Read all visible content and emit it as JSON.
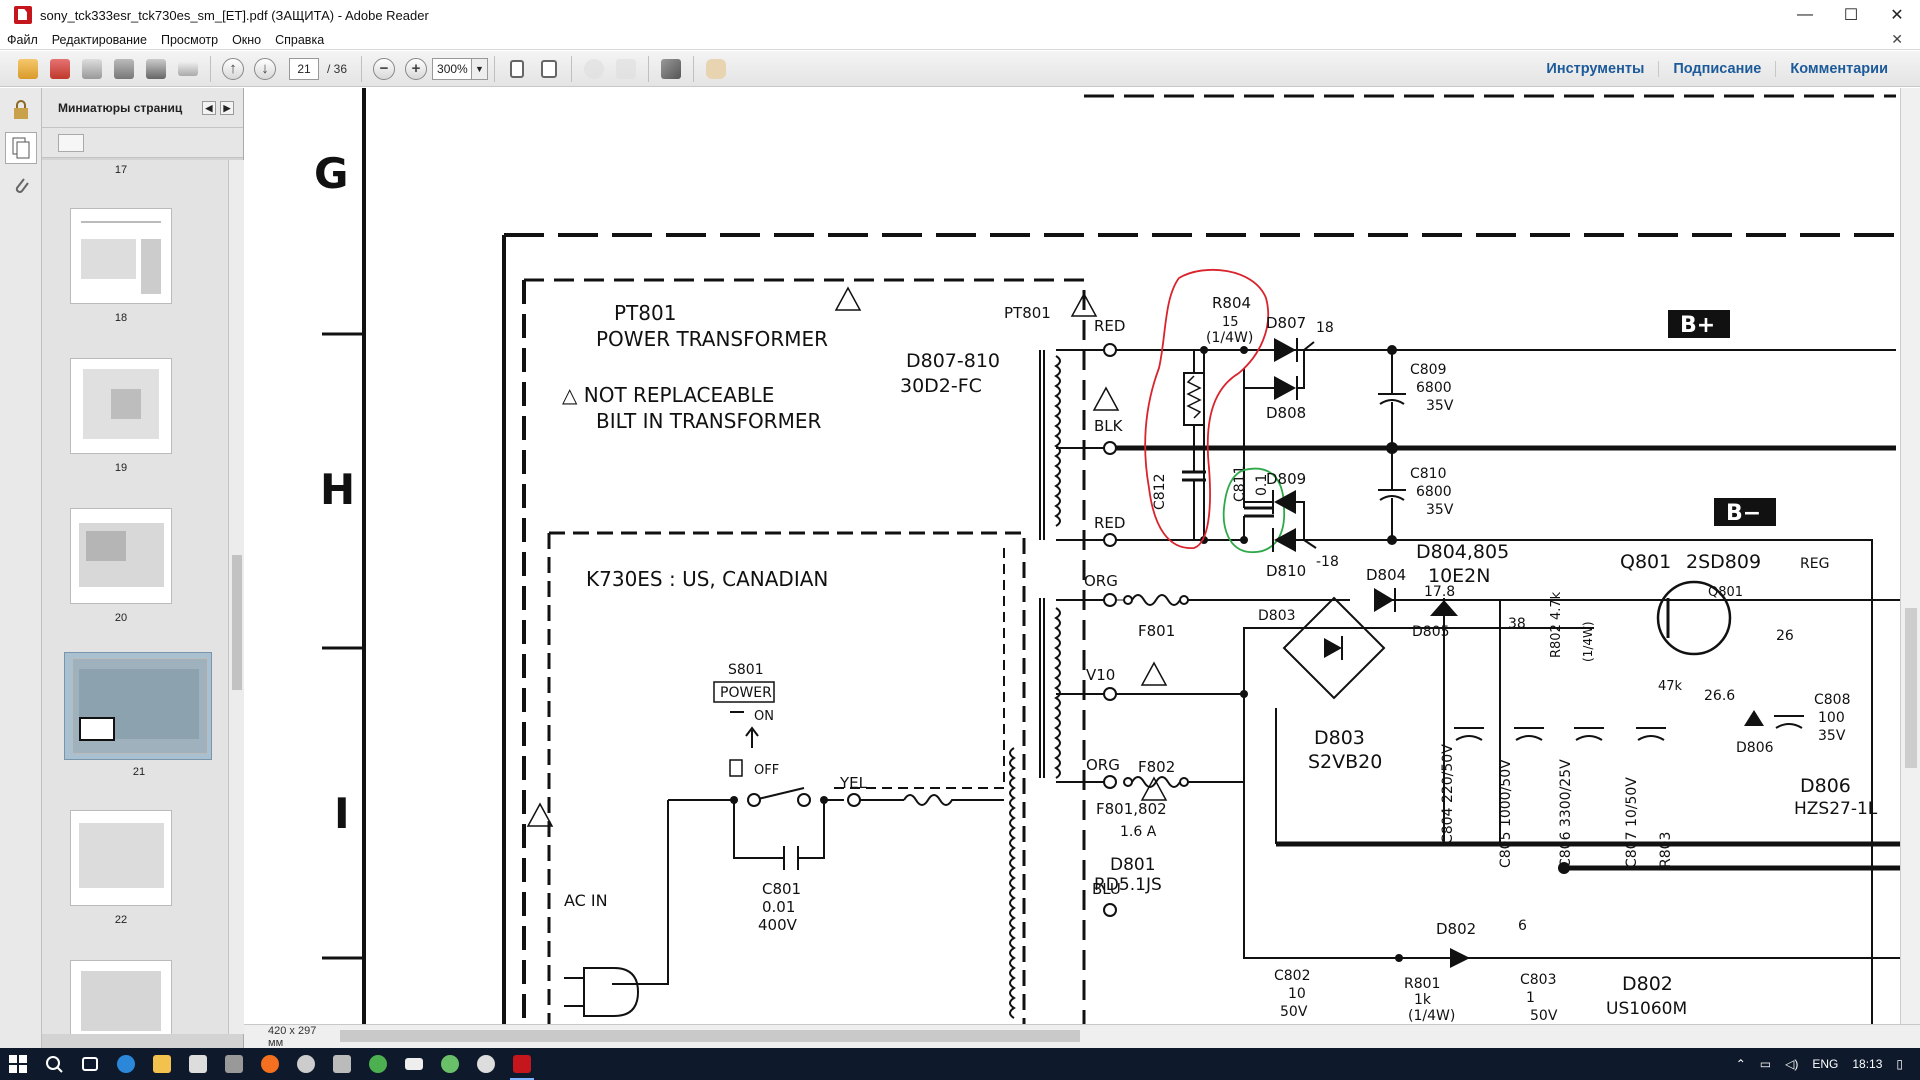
{
  "window": {
    "title": "sony_tck333esr_tck730es_sm_[ET].pdf (ЗАЩИТА) - Adobe Reader",
    "minimize": "—",
    "maximize": "☐",
    "close": "✕"
  },
  "menu": {
    "items": [
      "Файл",
      "Редактирование",
      "Просмотр",
      "Окно",
      "Справка"
    ],
    "close_doc": "✕"
  },
  "toolbar": {
    "current_page": "21",
    "total_pages": "/ 36",
    "zoom": "300%",
    "links": [
      "Инструменты",
      "Подписание",
      "Комментарии"
    ]
  },
  "thumbnails": {
    "header": "Миниатюры страниц",
    "pages": [
      "17",
      "18",
      "19",
      "20",
      "21",
      "22"
    ],
    "selected": "21"
  },
  "status": {
    "page_size": "420 x 297 мм"
  },
  "schematic": {
    "row_labels": [
      "G",
      "H",
      "I"
    ],
    "texts": {
      "pt801": "PT801",
      "power_transformer": "POWER TRANSFORMER",
      "not_replaceable": "△ NOT REPLACEABLE",
      "bilt_in": "BILT IN TRANSFORMER",
      "pt801b": "PT801",
      "d807_810": "D807-810",
      "d30d2": "30D2-FC",
      "red1": "RED",
      "blk": "BLK",
      "red2": "RED",
      "r804": "R804",
      "r804v": "15",
      "r804w": "(1/4W)",
      "c812": "C812",
      "c811": "C811",
      "c811v": "0.1",
      "d807": "D807",
      "d808": "D808",
      "d809": "D809",
      "d810": "D810",
      "v18": "18",
      "vm18": "-18",
      "c809": "C809",
      "c809v": "6800",
      "c809u": "35V",
      "c810": "C810",
      "c810v": "6800",
      "c810u": "35V",
      "bplus": "B+",
      "bminus": "B−",
      "d804_805": "D804,805",
      "d10e2n": "10E2N",
      "k730": "K730ES : US, CANADIAN",
      "s801": "S801",
      "power": "POWER",
      "on": "ON",
      "off": "OFF",
      "yel": "YEL",
      "ac_in": "AC IN",
      "c801": "C801",
      "c801v": "0.01",
      "c801u": "400V",
      "org1": "ORG",
      "f801": "F801",
      "v10": "V10",
      "org2": "ORG",
      "f802": "F802",
      "f801_802": "F801,802",
      "f16a": "1.6 A",
      "d801": "D801",
      "rd51": "RD5.1JS",
      "blu": "BLU",
      "d804": "D804",
      "v178": "17.8",
      "q801": "Q801",
      "q2sd809": "2SD809",
      "reg": "REG",
      "q801b": "Q801",
      "v38": "38",
      "v26": "26",
      "v266": "26.6",
      "d803": "D803",
      "d803b": "D803",
      "s2vb20": "S2VB20",
      "d805": "D805",
      "r802": "R802 4.7k",
      "r802w": "(1/4W)",
      "k47": "47k",
      "c804": "C804 220/50V",
      "c805": "C805 1000/50V",
      "c806": "C806 3300/25V",
      "c807": "C807 10/50V",
      "r803": "R803",
      "c808": "C808",
      "c808v": "100",
      "c808u": "35V",
      "d806": "D806",
      "d806b": "D806",
      "hzs27": "HZS27-1L",
      "d802": "D802",
      "v6": "6",
      "c802": "C802",
      "c802v": "10",
      "c802u": "50V",
      "r801": "R801",
      "r801v": "1k",
      "r801w": "(1/4W)",
      "c803": "C803",
      "c803v": "1",
      "c803u": "50V",
      "d802b": "D802",
      "us1060m": "US1060M"
    }
  },
  "taskbar": {
    "lang": "ENG",
    "time": "18:13"
  }
}
